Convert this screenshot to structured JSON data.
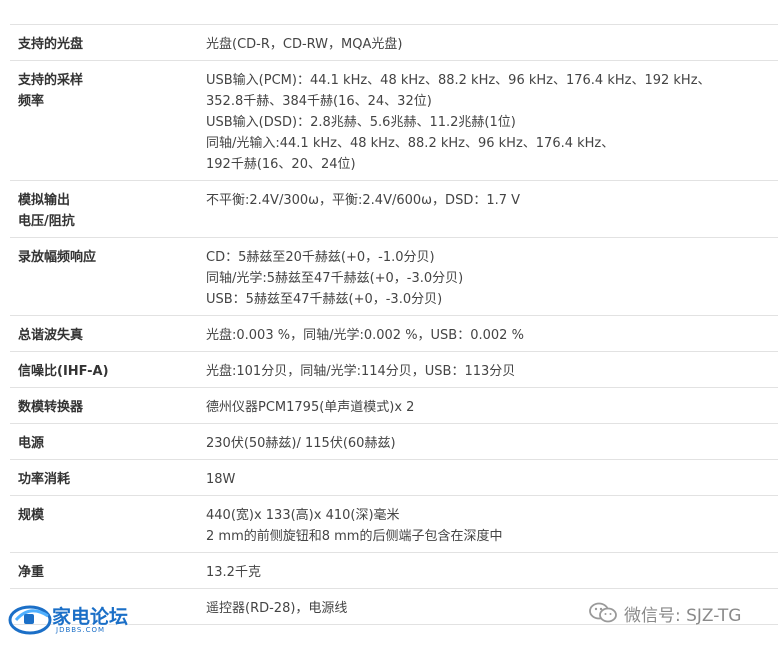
{
  "specs": [
    {
      "label": "支持的光盘",
      "lines": [
        "光盘(CD-R，CD-RW，MQA光盘)"
      ]
    },
    {
      "label": "支持的采样\n频率",
      "lines": [
        "USB输入(PCM)：44.1 kHz、48 kHz、88.2 kHz、96 kHz、176.4 kHz、192 kHz、",
        "352.8千赫、384千赫(16、24、32位)",
        "USB输入(DSD)：2.8兆赫、5.6兆赫、11.2兆赫(1位)",
        "同轴/光输入:44.1 kHz、48 kHz、88.2 kHz、96 kHz、176.4 kHz、",
        "192千赫(16、20、24位)"
      ]
    },
    {
      "label": "模拟输出\n电压/阻抗",
      "lines": [
        "不平衡:2.4V/300ω，平衡:2.4V/600ω，DSD：1.7 V"
      ]
    },
    {
      "label": "录放幅频响应",
      "lines": [
        "CD：5赫兹至20千赫兹(+0，-1.0分贝)",
        "同轴/光学:5赫兹至47千赫兹(+0，-3.0分贝)",
        "USB：5赫兹至47千赫兹(+0，-3.0分贝)"
      ]
    },
    {
      "label": "总谐波失真",
      "lines": [
        "光盘:0.003 %，同轴/光学:0.002 %，USB：0.002 %"
      ]
    },
    {
      "label": "信噪比(IHF-A)",
      "lines": [
        "光盘:101分贝，同轴/光学:114分贝，USB：113分贝"
      ]
    },
    {
      "label": "数模转换器",
      "lines": [
        "德州仪器PCM1795(单声道模式)x 2"
      ]
    },
    {
      "label": "电源",
      "lines": [
        "230伏(50赫兹)/ 115伏(60赫兹)"
      ]
    },
    {
      "label": "功率消耗",
      "lines": [
        "18W"
      ]
    },
    {
      "label": "规模",
      "lines": [
        "440(宽)x 133(高)x 410(深)毫米",
        "2 mm的前侧旋钮和8 mm的后侧端子包含在深度中"
      ]
    },
    {
      "label": "净重",
      "lines": [
        "13.2千克"
      ]
    },
    {
      "label": "",
      "lines": [
        "遥控器(RD-28)，电源线"
      ]
    }
  ],
  "logo": {
    "text": "家电论坛",
    "sub": "JDBBS.COM",
    "color": "#1b6fc7",
    "icon": "jdbbs-logo-icon"
  },
  "watermark": {
    "text": "微信号: SJZ-TG",
    "icon": "wechat-icon"
  }
}
